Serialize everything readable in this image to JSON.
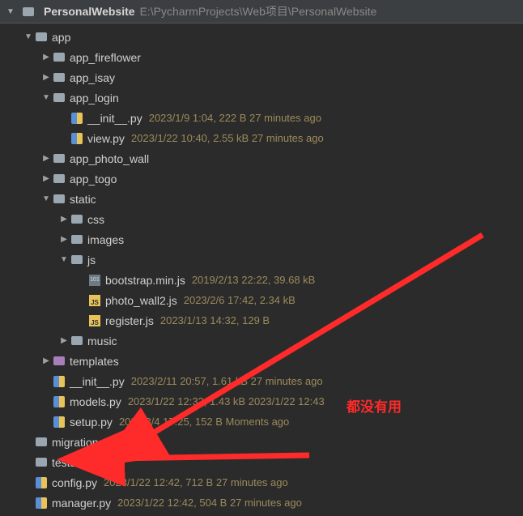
{
  "header": {
    "project": "PersonalWebsite",
    "path": "E:\\PycharmProjects\\Web项目\\PersonalWebsite"
  },
  "tree": [
    {
      "indent": 1,
      "chev": "v",
      "icon": "folder",
      "name": "app"
    },
    {
      "indent": 2,
      "chev": ">",
      "icon": "folder",
      "name": "app_fireflower"
    },
    {
      "indent": 2,
      "chev": ">",
      "icon": "folder",
      "name": "app_isay"
    },
    {
      "indent": 2,
      "chev": "v",
      "icon": "folder",
      "name": "app_login"
    },
    {
      "indent": 3,
      "chev": "",
      "icon": "py",
      "name": "__init__.py",
      "meta": "2023/1/9 1:04, 222 B 27 minutes ago"
    },
    {
      "indent": 3,
      "chev": "",
      "icon": "py",
      "name": "view.py",
      "meta": "2023/1/22 10:40, 2.55 kB 27 minutes ago"
    },
    {
      "indent": 2,
      "chev": ">",
      "icon": "folder",
      "name": "app_photo_wall"
    },
    {
      "indent": 2,
      "chev": ">",
      "icon": "folder",
      "name": "app_togo"
    },
    {
      "indent": 2,
      "chev": "v",
      "icon": "folder",
      "name": "static"
    },
    {
      "indent": 3,
      "chev": ">",
      "icon": "folder",
      "name": "css"
    },
    {
      "indent": 3,
      "chev": ">",
      "icon": "folder",
      "name": "images"
    },
    {
      "indent": 3,
      "chev": "v",
      "icon": "folder",
      "name": "js"
    },
    {
      "indent": 4,
      "chev": "",
      "icon": "bin",
      "name": "bootstrap.min.js",
      "meta": "2019/2/13 22:22, 39.68 kB"
    },
    {
      "indent": 4,
      "chev": "",
      "icon": "js",
      "name": "photo_wall2.js",
      "meta": "2023/2/6 17:42, 2.34 kB"
    },
    {
      "indent": 4,
      "chev": "",
      "icon": "js",
      "name": "register.js",
      "meta": "2023/1/13 14:32, 129 B"
    },
    {
      "indent": 3,
      "chev": ">",
      "icon": "folder",
      "name": "music"
    },
    {
      "indent": 2,
      "chev": ">",
      "icon": "folder-purple",
      "name": "templates"
    },
    {
      "indent": 2,
      "chev": "",
      "icon": "py",
      "name": "__init__.py",
      "meta": "2023/2/11 20:57, 1.61 kB 27 minutes ago"
    },
    {
      "indent": 2,
      "chev": "",
      "icon": "py",
      "name": "models.py",
      "meta": "2023/1/22 12:32, 1.43 kB 2023/1/22 12:43"
    },
    {
      "indent": 2,
      "chev": "",
      "icon": "py",
      "name": "setup.py",
      "meta": "2023/3/4 17:25, 152 B Moments ago"
    },
    {
      "indent": 1,
      "chev": "",
      "icon": "folder",
      "name": "migrations"
    },
    {
      "indent": 1,
      "chev": "",
      "icon": "folder",
      "name": "tests"
    },
    {
      "indent": 1,
      "chev": "",
      "icon": "py",
      "name": "config.py",
      "meta": "2023/1/22 12:42, 712 B 27 minutes ago"
    },
    {
      "indent": 1,
      "chev": "",
      "icon": "py",
      "name": "manager.py",
      "meta": "2023/1/22 12:42, 504 B 27 minutes ago"
    }
  ],
  "annotations": {
    "text": "都没有用"
  }
}
